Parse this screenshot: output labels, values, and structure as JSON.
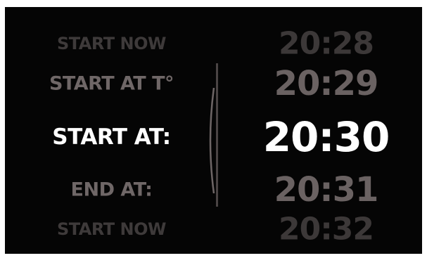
{
  "mode_picker": {
    "items": [
      "START NOW",
      "START AT T°",
      "START AT:",
      "END AT:",
      "START NOW"
    ],
    "selected": "START AT:"
  },
  "time_picker": {
    "items": [
      "20:28",
      "20:29",
      "20:30",
      "20:31",
      "20:32"
    ],
    "selected": "20:30"
  },
  "colors": {
    "background": "#050505",
    "selected": "#ffffff",
    "adjacent": "#6f6767",
    "faded": "#3e3a3a"
  }
}
